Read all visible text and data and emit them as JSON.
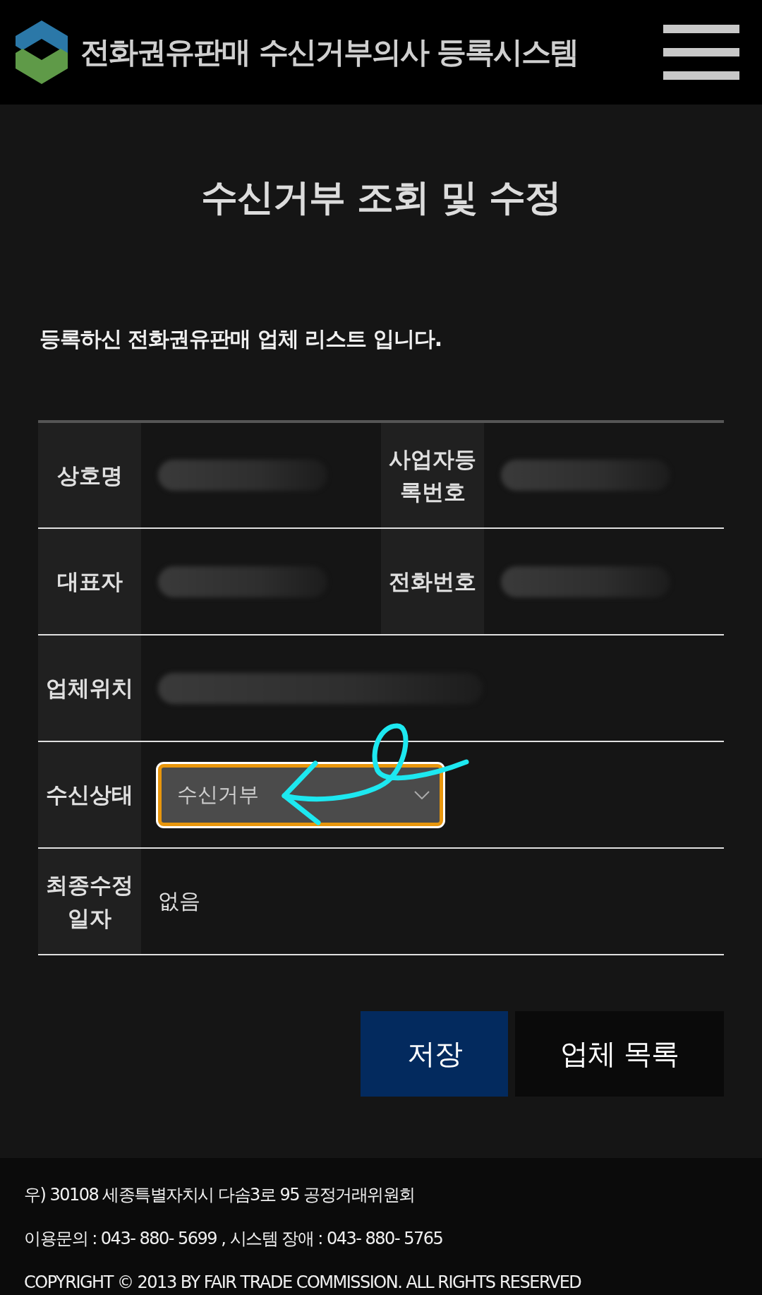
{
  "header": {
    "title": "전화권유판매 수신거부의사 등록시스템"
  },
  "page_title": "수신거부 조회 및 수정",
  "intro": "등록하신 전화권유판매 업체 리스트 입니다.",
  "table": {
    "rows": [
      {
        "cells": [
          {
            "label": "상호명",
            "value": {
              "kind": "blurred"
            }
          },
          {
            "label": "사업자등록번호",
            "value": {
              "kind": "blurred"
            }
          }
        ]
      },
      {
        "cells": [
          {
            "label": "대표자",
            "value": {
              "kind": "blurred"
            }
          },
          {
            "label": "전화번호",
            "value": {
              "kind": "blurred"
            }
          }
        ]
      },
      {
        "cells": [
          {
            "label": "업체위치",
            "value": {
              "kind": "blurred"
            }
          }
        ]
      },
      {
        "cells": [
          {
            "label": "수신상태",
            "value": {
              "kind": "select",
              "value": "수신거부",
              "focused": true
            }
          }
        ]
      },
      {
        "cells": [
          {
            "label": "최종수정일자",
            "value": {
              "kind": "text",
              "text": "없음"
            }
          }
        ]
      }
    ]
  },
  "annotation": {
    "kind": "arrow"
  },
  "buttons": [
    {
      "label": "저장",
      "kind": "primary"
    },
    {
      "label": "업체 목록",
      "kind": "secondary"
    }
  ],
  "footer": {
    "lines": [
      "우) 30108 세종특별자치시 다솜3로 95 공정거래위원회",
      "이용문의 : 043- 880- 5699 , 시스템 장애 : 043- 880- 5765",
      "COPYRIGHT © 2013 BY FAIR TRADE COMMISSION. ALL RIGHTS RESERVED"
    ]
  }
}
